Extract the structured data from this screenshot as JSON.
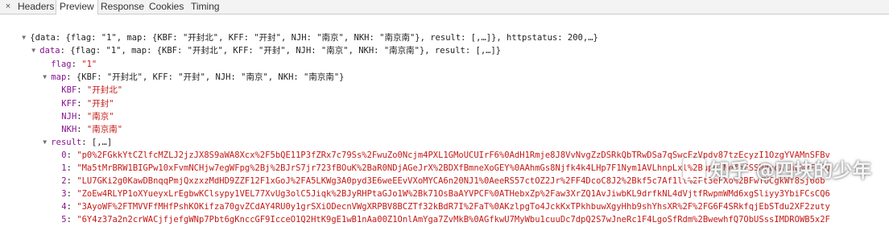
{
  "tabs": {
    "close_glyph": "×",
    "items": [
      "Headers",
      "Preview",
      "Response",
      "Cookies",
      "Timing"
    ],
    "active": "Preview"
  },
  "tree": {
    "root_summary": "{data: {flag: \"1\", map: {KBF: \"开封北\", KFF: \"开封\", NJH: \"南京\", NKH: \"南京南\"}, result: [,…]}, httpstatus: 200,…}",
    "data_label": "data",
    "data_summary": "{flag: \"1\", map: {KBF: \"开封北\", KFF: \"开封\", NJH: \"南京\", NKH: \"南京南\"}, result: [,…]}",
    "flag_label": "flag",
    "flag_value": "\"1\"",
    "map_label": "map",
    "map_summary": "{KBF: \"开封北\", KFF: \"开封\", NJH: \"南京\", NKH: \"南京南\"}",
    "map_items": [
      {
        "key": "KBF",
        "value": "\"开封北\""
      },
      {
        "key": "KFF",
        "value": "\"开封\""
      },
      {
        "key": "NJH",
        "value": "\"南京\""
      },
      {
        "key": "NKH",
        "value": "\"南京南\""
      }
    ],
    "result_label": "result",
    "result_summary": "[,…]",
    "result_items": [
      {
        "index": "0",
        "value": "\"p0%2FGkkYtCZlfcMZLJ2jzJX8S9aWA8Xcx%2F5bQE11P3fZRx7c79Ss%2FwuZo0Ncjm4PXL1GMoUCUIrF6%0AdH1Rmje8J8VvNvgZzDSRkQbTRwDSa7qSwcFzVpdv87tzEcyzI1OzgYVAMnSFBv"
      },
      {
        "index": "1",
        "value": "\"Ma5tMrBRW1BIGPw10xFvmNCHjw7egWFpg%2Bj%2BJrS7jr723fBOuK%2BaR0NDjAGeJrX%2BDXfBmneXoGEY%0AAhmGs8Njfk4k4LHp7F1Nym1AVLhnpLxl%2Bupb1NefnFSSNdada1hb%2FLFQ"
      },
      {
        "index": "2",
        "value": "\"LU7GKi2g0KawDBnqqPmjQxzxzMdHD9ZZF12F1xGoJ%2FA5LKWg3A0pyd3E6weEEvVXoMYCA6n20NJ1%0AeeRS57ctOZ2Jr%2FF4DcoC8J2%2Bkf5c7Af1lt%2Ft3eFXo%2BFwTUCgkWf8Sj6ob"
      },
      {
        "index": "3",
        "value": "\"ZoEw4RLYP1oXYueyxLrEgbwKClsypy1VEL77XvUg3olC5Jiqk%2BJyRHPtaGJo1W%2Bk71OsBaAYVPCF%0ATHebxZp%2Faw3XrZQ1AvJiwbKL9drfkNL4dVjtfRwpmWMd6xgSliyy3YbiFCsCQ6"
      },
      {
        "index": "4",
        "value": "\"3AyoWF%2FTMVVFfMHfPshKOKifza70gvZCdAY4RU0y1grSXiODecnVWgXRPBV8BCZTf32kBdR7I%2FaT%0AKzlpgTo4JckKxTPkhbuwXgyHhb9shYhsXR%2F%2FG6F4SRkfqjEbSTdu2XF2zuty"
      },
      {
        "index": "5",
        "value": "\"6Y4z37a2n2crWACjfjefgWNp7Pbt6gKnccGF9IcceO1Q2HtK9gE1wB1nAa00Z1OnlAmYga7ZvMkB%0AGfkwU7MyWbu1cuuDc7dpQ2S7wJneRc1F4LgoSfRdm%2BwewhfQ7ObUSssIMDROWB5x2F"
      }
    ]
  },
  "watermark": "知乎 @四块的少年"
}
